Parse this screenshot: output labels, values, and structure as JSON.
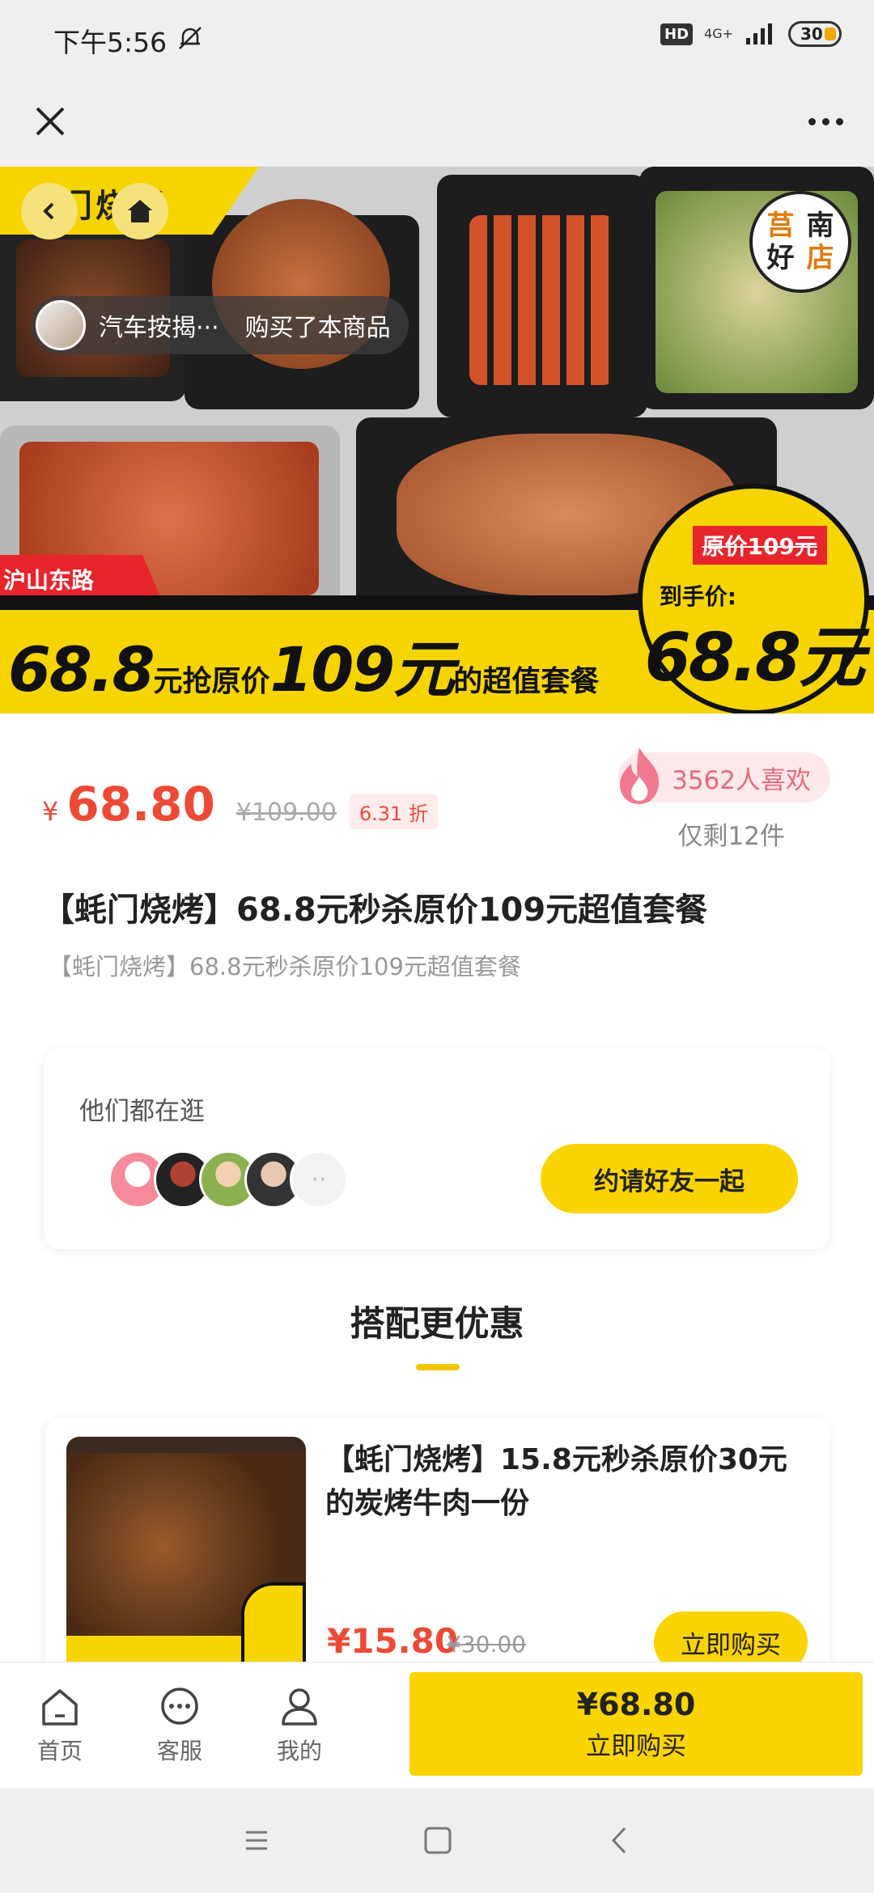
{
  "status_bar": {
    "time": "下午5:56",
    "hd": "HD",
    "network": "4G+",
    "battery": "30"
  },
  "hero": {
    "brand": "蚝门烧烤",
    "stamp_chars": [
      "莒",
      "南",
      "好",
      "店"
    ],
    "buyer_name": "汽车按揭···",
    "buyer_action": "购买了本商品",
    "location": "沪山东路",
    "banner_price": "68.8",
    "banner_unit": "元抢原价",
    "banner_orig": "109元",
    "banner_suffix": "的超值套餐",
    "orig_price_tag": "原价109元",
    "to_hand_label": "到手价:",
    "to_hand_price": "68.8元"
  },
  "product": {
    "currency": "¥",
    "price": "68.80",
    "original_price": "¥109.00",
    "discount": "6.31 折",
    "likes": "3562人喜欢",
    "remaining": "仅剩12件",
    "title": "【蚝门烧烤】68.8元秒杀原价109元超值套餐",
    "subtitle": "【蚝门烧烤】68.8元秒杀原价109元超值套餐"
  },
  "friends": {
    "label": "他们都在逛",
    "invite_label": "约请好友一起"
  },
  "combo": {
    "section_title": "搭配更优惠",
    "item_title": "【蚝门烧烤】15.8元秒杀原价30元的炭烤牛肉一份",
    "item_price": "¥15.80",
    "item_original_price": "¥30.00",
    "buy_label": "立即购买"
  },
  "bottom_bar": {
    "tabs": [
      {
        "label": "首页",
        "icon": "home-icon"
      },
      {
        "label": "客服",
        "icon": "chat-icon"
      },
      {
        "label": "我的",
        "icon": "user-icon"
      }
    ],
    "buy_price": "¥68.80",
    "buy_label": "立即购买"
  },
  "colors": {
    "accent_yellow": "#fad400",
    "price_red": "#ec4a36",
    "likes_pink": "#e46a7b"
  }
}
